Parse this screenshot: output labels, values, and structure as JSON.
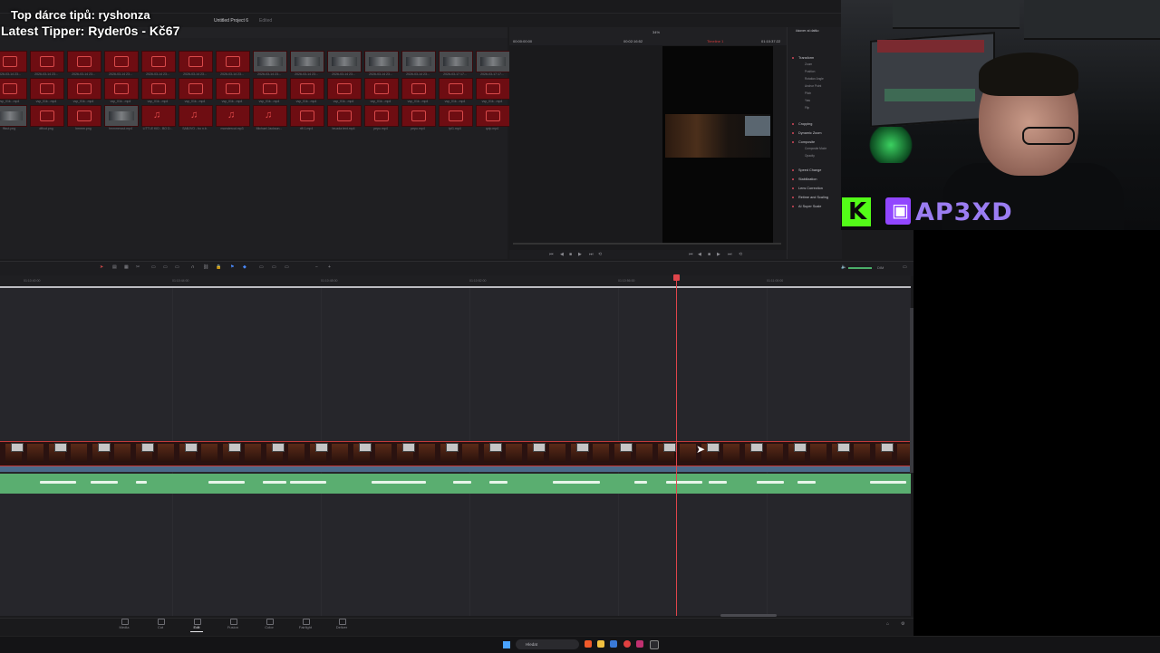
{
  "stream_overlay": {
    "top_donor": "Top dárce tipů: ryshonza",
    "latest_tipper": "Latest Tipper: Ryder0s - Kč67"
  },
  "project": {
    "title": "Untitled Project 6",
    "status": "Edited"
  },
  "media_pool": {
    "rows": [
      {
        "labels": [
          "2026-03-14 23...",
          "2026-03-14 23...",
          "2026-03-14 23...",
          "2026-03-14 23...",
          "2026-03-14 23...",
          "2026-03-14 23...",
          "2026-03-14 23...",
          "2026-03-14 23...",
          "2026-03-14 23...",
          "2026-03-14 23...",
          "2026-03-14 23...",
          "2026-03-14 23...",
          "2026-03-17 17...",
          "2026-03-17 17..."
        ]
      },
      {
        "labels": [
          "vsp_01k...mp4",
          "vsp_01k...mp4",
          "vsp_01k...mp4",
          "vsp_01k...mp4",
          "vsp_01k...mp4",
          "vsp_01k...mp4",
          "vsp_01k...mp4",
          "vsp_01k...mp4",
          "vsp_01k...mp4",
          "vsp_01k...mp4",
          "vsp_01k...mp4",
          "vsp_01k...mp4",
          "vsp_01k...mp4",
          "vsp_01k...mp4"
        ]
      },
      {
        "labels": [
          "fftcut.png",
          "dffcut.png",
          "hmmm.png",
          "hmmmmcut.mp4",
          "LITTLE KID - BO D...",
          "SABJVO - bo n.b.",
          "monstercut.mp3",
          "Michael Jackson...",
          "rift 1.mp4",
          "bruzda text.mp4",
          "pepo.mp4",
          "pepo.mp4",
          "tpl1.mp4",
          "qvip.mp4"
        ]
      }
    ]
  },
  "viewer": {
    "timecode_left": "00:00:00:00",
    "timecode_mid": "00:02:16:52",
    "timeline_name": "Timeline 1",
    "timecode_right": "01:10:37:22",
    "zoom": "34%"
  },
  "inspector": {
    "title": "čáover ai dalšo",
    "tabs": [
      "Video",
      "Audio",
      "Effects",
      "Transition",
      "Image",
      "File"
    ],
    "sections": [
      {
        "label": "Transform",
        "sub": [
          "Zoom",
          "Position",
          "Rotation Angle",
          "Anchor Point",
          "Pitch",
          "Yaw",
          "Flip"
        ]
      },
      {
        "label": "Cropping",
        "sub": []
      },
      {
        "label": "Dynamic Zoom",
        "sub": []
      },
      {
        "label": "Composite",
        "sub": [
          "Composite Mode",
          "Opacity"
        ]
      },
      {
        "label": "Speed Change",
        "sub": []
      },
      {
        "label": "Stabilization",
        "sub": []
      },
      {
        "label": "Lens Correction",
        "sub": []
      },
      {
        "label": "Retime and Scaling",
        "sub": []
      },
      {
        "label": "AI Super Scale",
        "sub": []
      }
    ]
  },
  "social": {
    "handle": "AP3XD",
    "kick_icon": "kick-icon",
    "twitch_icon": "twitch-icon"
  },
  "timeline": {
    "ruler_ticks": [
      "01:10:40:00",
      "01:10:44:00",
      "01:10:48:00",
      "01:10:52:00",
      "01:10:56:00",
      "01:11:00:00"
    ],
    "audio_meter_label": "DIM"
  },
  "page_nav": {
    "pages": [
      "Media",
      "Cut",
      "Edit",
      "Fusion",
      "Color",
      "Fairlight",
      "Deliver"
    ],
    "active": "Edit"
  },
  "taskbar": {
    "search_placeholder": "Hledat"
  },
  "colors": {
    "video_clip": "#c23b3b",
    "audio_clip": "#5aae70",
    "playhead": "#e0454b",
    "kick": "#53fc18",
    "twitch": "#9146ff"
  }
}
